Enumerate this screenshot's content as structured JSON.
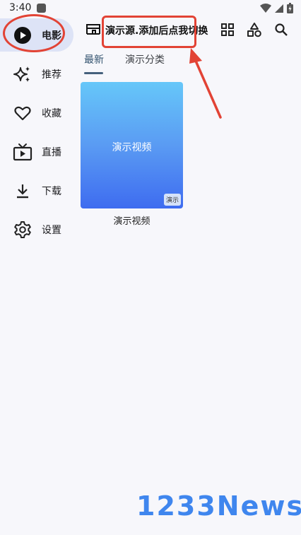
{
  "status_bar": {
    "time": "3:40"
  },
  "sidebar": {
    "items": [
      {
        "label": "电影",
        "icon": "play-circle-icon",
        "active": true
      },
      {
        "label": "推荐",
        "icon": "sparkle-icon"
      },
      {
        "label": "收藏",
        "icon": "heart-icon"
      },
      {
        "label": "直播",
        "icon": "tv-icon"
      },
      {
        "label": "下载",
        "icon": "download-icon"
      },
      {
        "label": "设置",
        "icon": "gear-icon"
      }
    ]
  },
  "header": {
    "source_title": "演示源.添加后点我切换",
    "actions": [
      "grid-icon",
      "shapes-icon",
      "search-icon"
    ]
  },
  "tabs": [
    {
      "label": "最新",
      "active": true
    },
    {
      "label": "演示分类",
      "active": false
    }
  ],
  "videos": [
    {
      "title": "演示视频",
      "badge": "演示",
      "caption": "演示视频"
    }
  ],
  "watermark": "1233News",
  "colors": {
    "accent": "#45607c",
    "active_nav_bg": "#dde3f6",
    "annotation": "#e24335"
  }
}
